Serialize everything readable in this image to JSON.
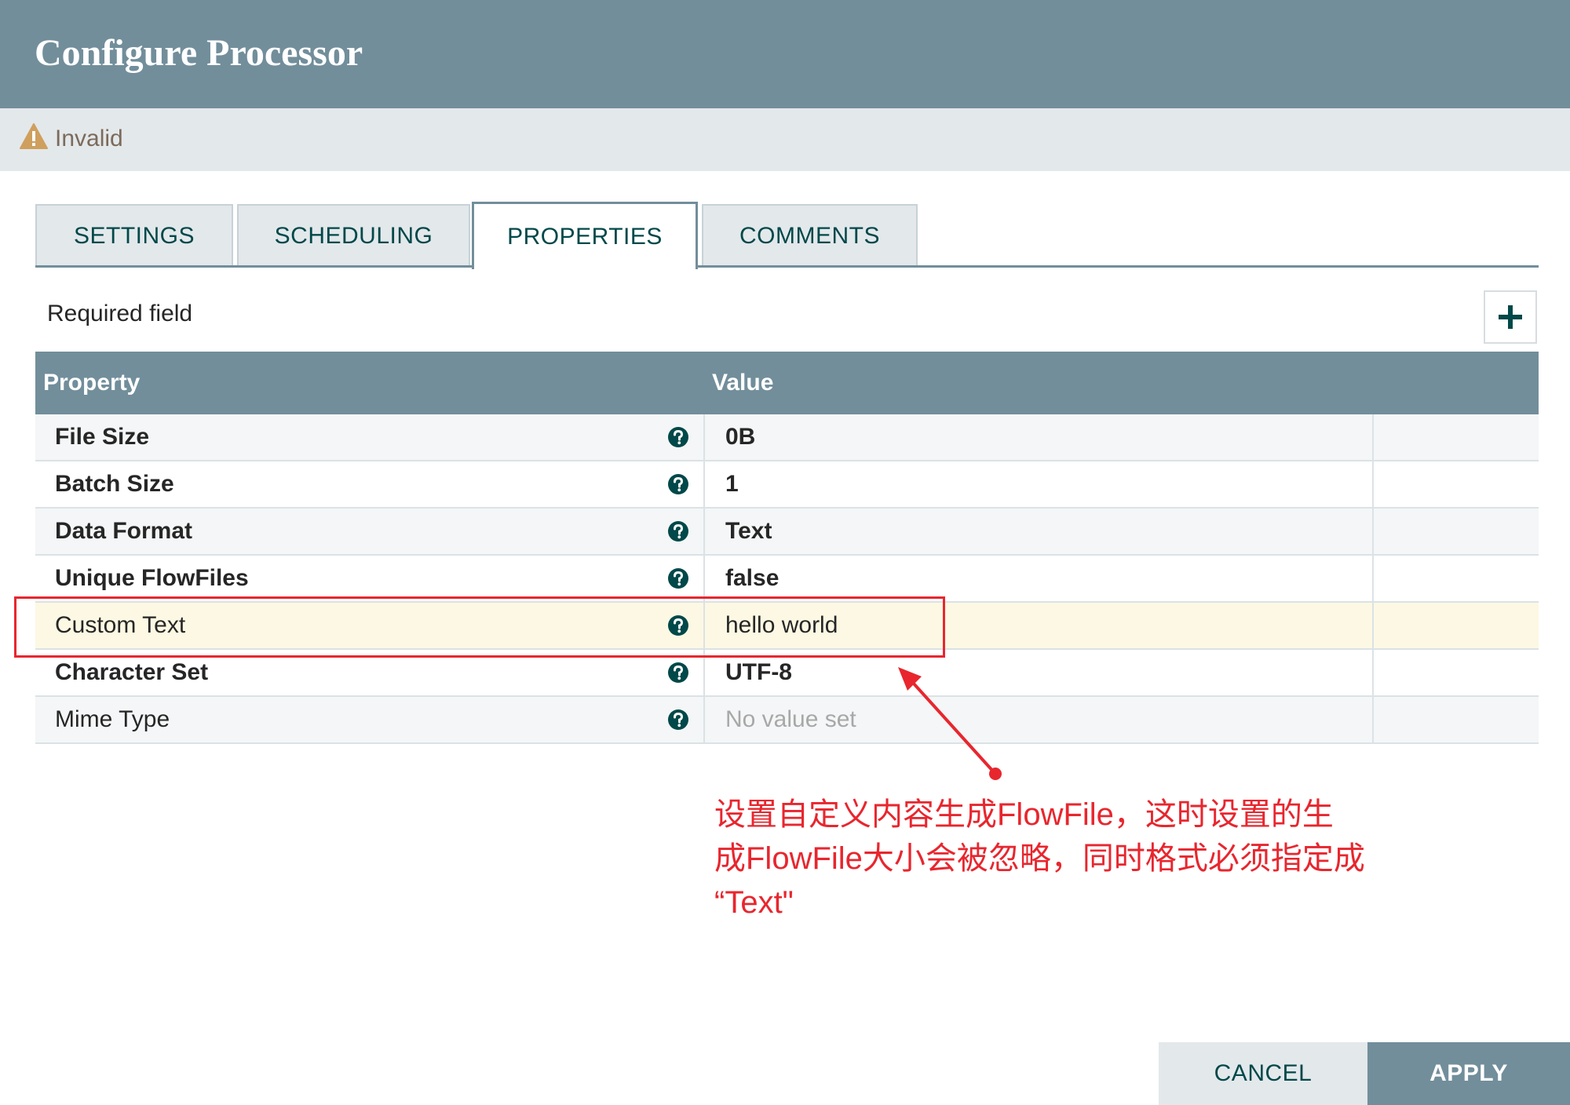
{
  "dialog": {
    "title": "Configure Processor",
    "status": "Invalid",
    "status_icon": "warning-icon"
  },
  "tabs": [
    {
      "label": "SETTINGS",
      "active": false
    },
    {
      "label": "SCHEDULING",
      "active": false
    },
    {
      "label": "PROPERTIES",
      "active": true
    },
    {
      "label": "COMMENTS",
      "active": false
    }
  ],
  "properties": {
    "required_label": "Required field",
    "add_icon": "plus-icon",
    "columns": {
      "property": "Property",
      "value": "Value"
    },
    "rows": [
      {
        "name": "File Size",
        "value": "0B",
        "required": true,
        "help_icon": "question-circle-icon"
      },
      {
        "name": "Batch Size",
        "value": "1",
        "required": true,
        "help_icon": "question-circle-icon"
      },
      {
        "name": "Data Format",
        "value": "Text",
        "required": true,
        "help_icon": "question-circle-icon"
      },
      {
        "name": "Unique FlowFiles",
        "value": "false",
        "required": true,
        "help_icon": "question-circle-icon"
      },
      {
        "name": "Custom Text",
        "value": "hello world",
        "required": false,
        "highlighted": true,
        "help_icon": "question-circle-icon"
      },
      {
        "name": "Character Set",
        "value": "UTF-8",
        "required": true,
        "help_icon": "question-circle-icon"
      },
      {
        "name": "Mime Type",
        "value": "No value set",
        "required": false,
        "unset": true,
        "help_icon": "question-circle-icon"
      }
    ]
  },
  "annotation": {
    "line1": "设置自定义内容生成FlowFile，这时设置的生",
    "line2": "成FlowFile大小会被忽略，同时格式必须指定成",
    "line3": "“Text\"",
    "color": "#e8262e"
  },
  "footer": {
    "cancel_label": "CANCEL",
    "apply_label": "APPLY"
  },
  "colors": {
    "header": "#728e9b",
    "status_bar": "#e3e8eb",
    "highlight_row": "#fcf8e3",
    "accent_text": "#004849"
  }
}
